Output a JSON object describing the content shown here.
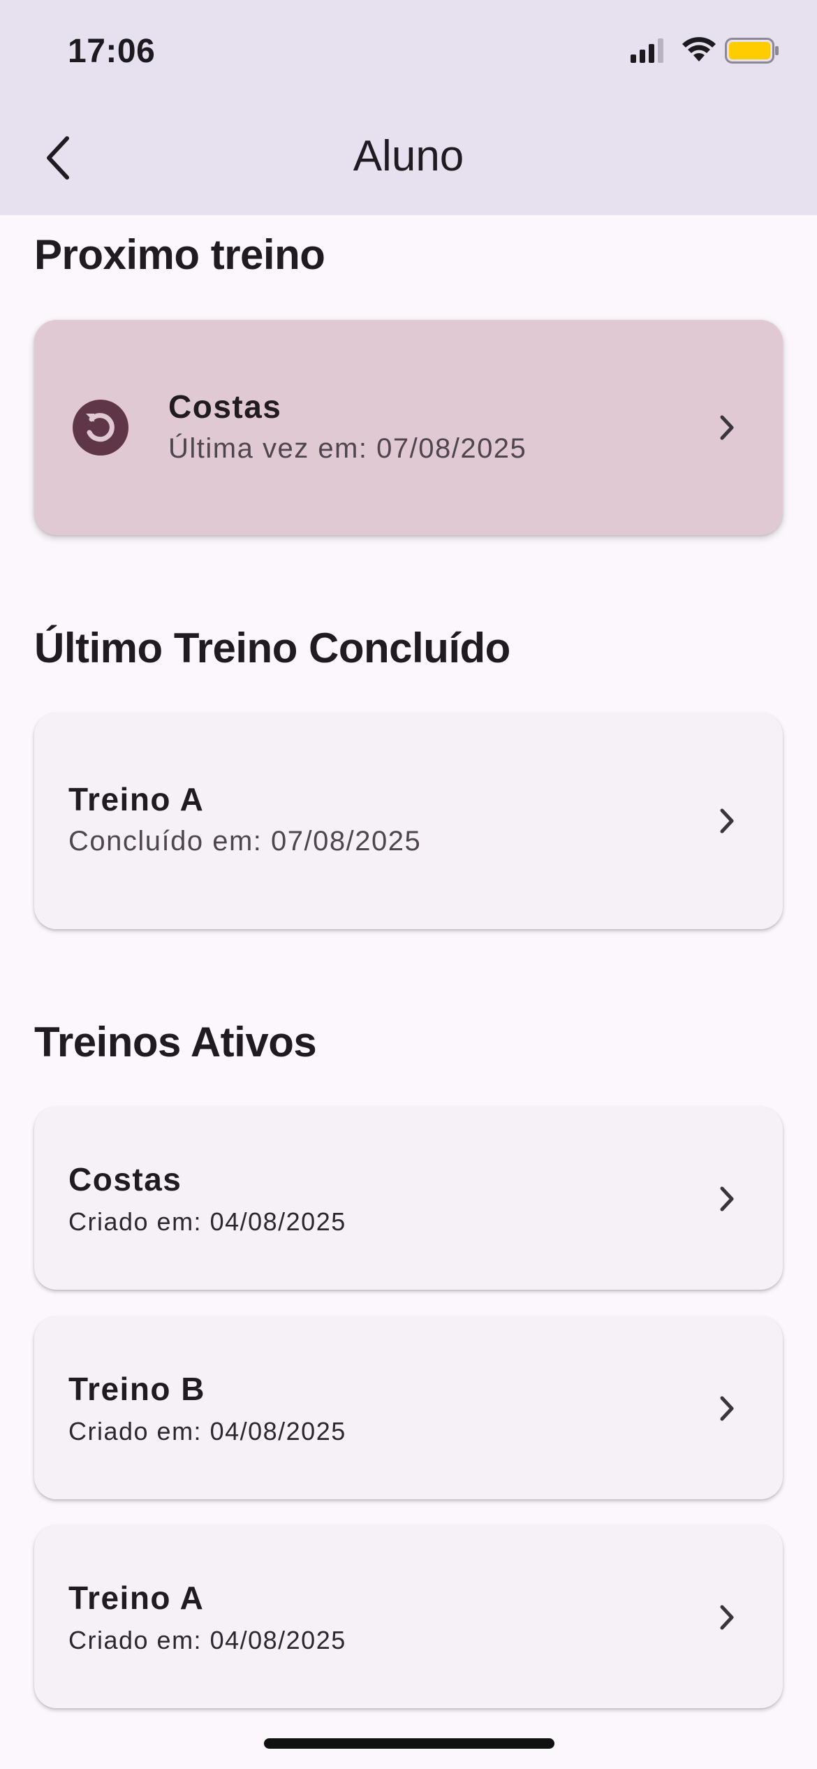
{
  "status_bar": {
    "time": "17:06",
    "battery_color": "#ffcc00"
  },
  "app_bar": {
    "title": "Aluno",
    "back_icon": "chevron-left-icon"
  },
  "next_workout": {
    "heading": "Proximo treino",
    "card": {
      "icon": "restart-icon",
      "title": "Costas",
      "subtitle": "Última vez em: 07/08/2025",
      "color": "#e0c9d2"
    }
  },
  "last_completed": {
    "heading": "Último Treino Concluído",
    "card": {
      "title": "Treino A",
      "subtitle": "Concluído em: 07/08/2025"
    }
  },
  "active_workouts": {
    "heading": "Treinos Ativos",
    "items": [
      {
        "title": "Costas",
        "subtitle": "Criado em: 04/08/2025"
      },
      {
        "title": "Treino B",
        "subtitle": "Criado em: 04/08/2025"
      },
      {
        "title": "Treino A",
        "subtitle": "Criado em: 04/08/2025"
      }
    ]
  },
  "colors": {
    "app_bar_bg": "#e7e0ee",
    "page_bg": "#fcf7fc",
    "card_bg": "#f5f1f7",
    "icon_accent": "#5f3647"
  }
}
